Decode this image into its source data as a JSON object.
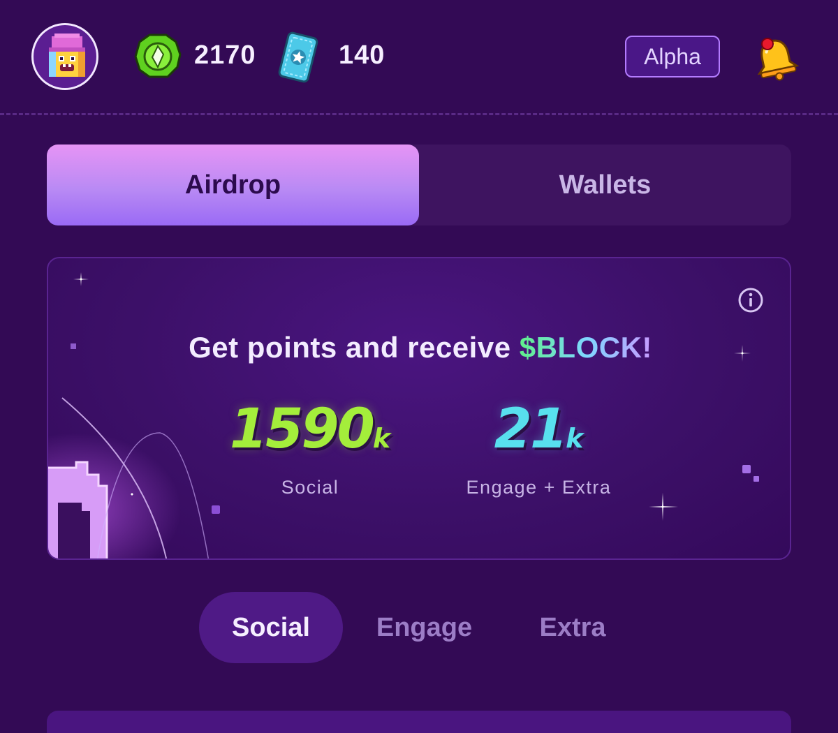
{
  "header": {
    "coins": "2170",
    "tickets": "140",
    "badge": "Alpha"
  },
  "tabs": {
    "airdrop": "Airdrop",
    "wallets": "Wallets",
    "active": "Airdrop"
  },
  "card": {
    "headline_prefix": "Get points and receive ",
    "headline_token": "$BLOCK!",
    "social": {
      "value": "1590",
      "unit": "k",
      "label": "Social"
    },
    "engage": {
      "value": "21",
      "unit": "k",
      "label": "Engage + Extra"
    }
  },
  "section_tabs": {
    "items": [
      "Social",
      "Engage",
      "Extra"
    ],
    "active": "Social"
  },
  "colors": {
    "background": "#330a55",
    "accent_purple": "#9a6af5",
    "social_green": "#a4ee3b",
    "engage_cyan": "#58e0ee"
  }
}
